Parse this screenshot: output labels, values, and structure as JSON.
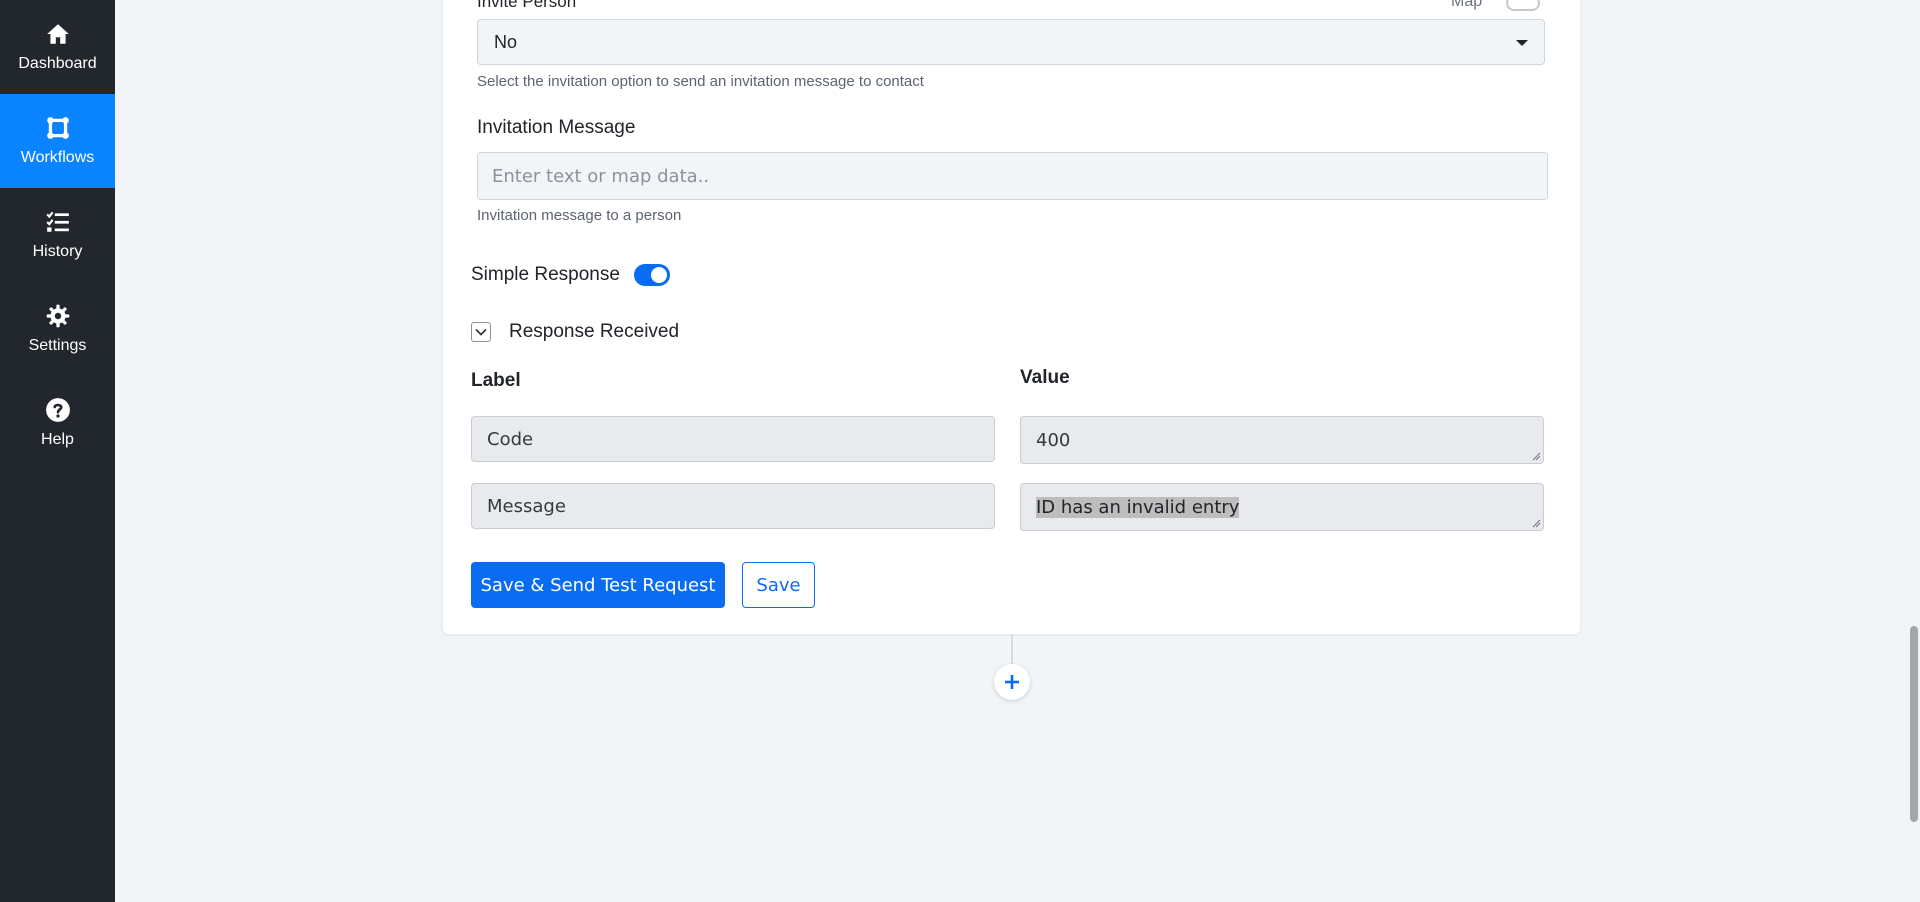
{
  "sidebar": {
    "items": [
      {
        "label": "Dashboard",
        "icon": "home-icon",
        "active": false
      },
      {
        "label": "Workflows",
        "icon": "workflow-icon",
        "active": true
      },
      {
        "label": "History",
        "icon": "checklist-icon",
        "active": false
      },
      {
        "label": "Settings",
        "icon": "gear-icon",
        "active": false
      },
      {
        "label": "Help",
        "icon": "question-circle-icon",
        "active": false
      }
    ]
  },
  "form": {
    "invite_person_label": "Invite Person",
    "map_label": "Map",
    "invite_person_value": "No",
    "invite_person_help": "Select the invitation option to send an invitation message to contact",
    "invitation_message_label": "Invitation Message",
    "invitation_message_placeholder": "Enter text or map data..",
    "invitation_message_help": "Invitation message to a person",
    "simple_response_label": "Simple Response",
    "simple_response_enabled": true,
    "response_received_label": "Response Received",
    "columns": {
      "label": "Label",
      "value": "Value"
    },
    "response_rows": [
      {
        "label": "Code",
        "value": "400"
      },
      {
        "label": "Message",
        "value": "ID has an invalid entry"
      }
    ],
    "buttons": {
      "save_and_test": "Save & Send Test Request",
      "save": "Save"
    }
  },
  "colors": {
    "sidebar_bg": "#22272e",
    "accent": "#0a84ff",
    "primary_button": "#0a6cf0",
    "page_bg": "#f2f5f8"
  }
}
